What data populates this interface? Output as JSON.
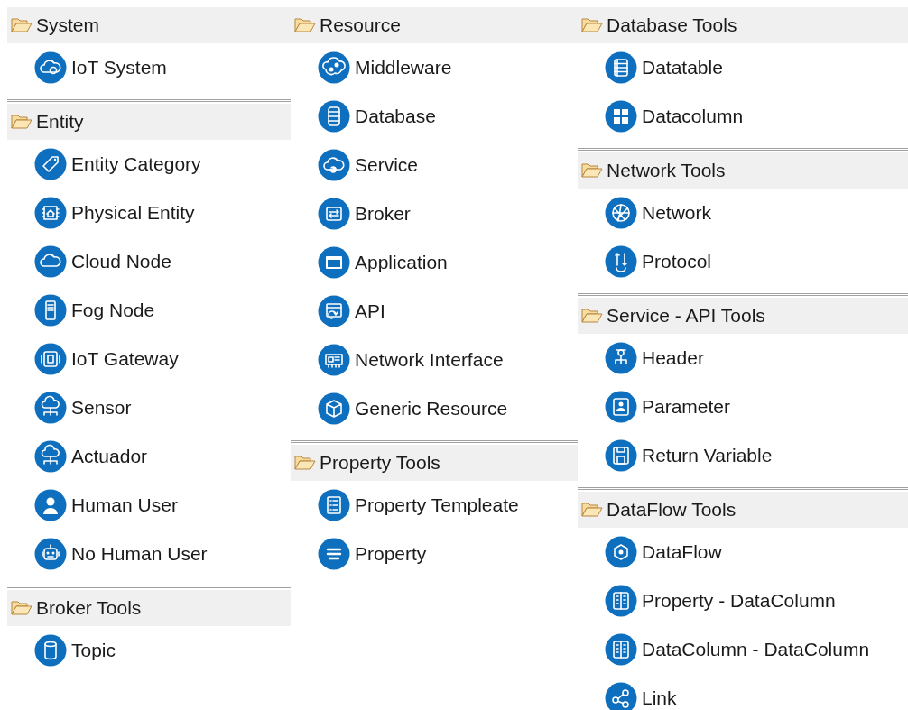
{
  "columns": [
    [
      {
        "title": "System",
        "items": [
          "IoT System"
        ]
      },
      {
        "title": "Entity",
        "items": [
          "Entity Category",
          "Physical Entity",
          "Cloud Node",
          "Fog Node",
          "IoT Gateway",
          "Sensor",
          "Actuador",
          "Human User",
          "No Human User"
        ]
      },
      {
        "title": "Broker Tools",
        "items": [
          "Topic"
        ]
      }
    ],
    [
      {
        "title": "Resource",
        "items": [
          "Middleware",
          "Database",
          "Service",
          "Broker",
          "Application",
          "API",
          "Network Interface",
          "Generic Resource"
        ]
      },
      {
        "title": "Property Tools",
        "items": [
          "Property Templeate",
          "Property"
        ]
      }
    ],
    [
      {
        "title": "Database Tools",
        "items": [
          "Datatable",
          "Datacolumn"
        ]
      },
      {
        "title": "Network Tools",
        "items": [
          "Network",
          "Protocol"
        ]
      },
      {
        "title": "Service - API Tools",
        "items": [
          "Header",
          "Parameter",
          "Return Variable"
        ]
      },
      {
        "title": "DataFlow Tools",
        "items": [
          "DataFlow",
          "Property - DataColumn",
          "DataColumn - DataColumn",
          "Link"
        ]
      }
    ]
  ]
}
